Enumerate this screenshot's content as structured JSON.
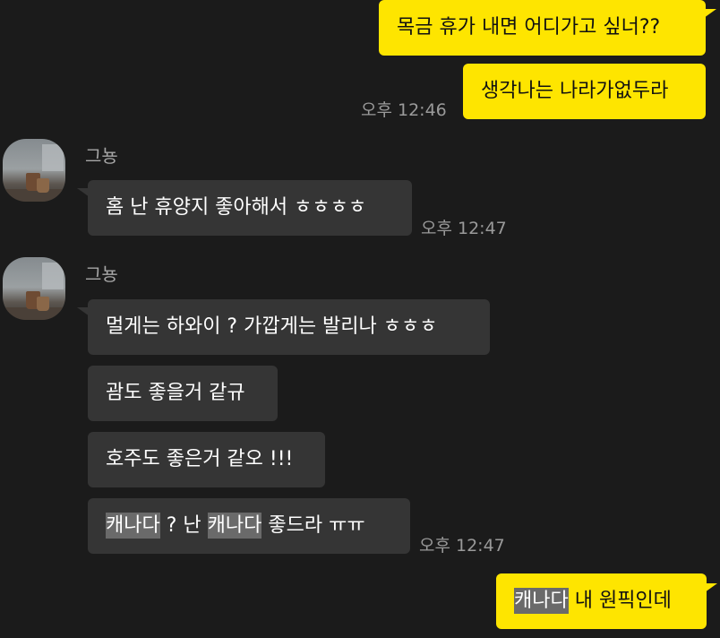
{
  "conversation": {
    "outgoing_1": {
      "text": "목금 휴가 내면 어디가고 싶너??"
    },
    "outgoing_2": {
      "text": "생각나는 나라가없두라",
      "time": "오후 12:46"
    },
    "incoming_group_1": {
      "sender": "그뇽",
      "avatar": "profile-photo-cafe",
      "messages": [
        {
          "text": "홈 난 휴양지 좋아해서 ㅎㅎㅎㅎ"
        }
      ],
      "time": "오후 12:47"
    },
    "incoming_group_2": {
      "sender": "그뇽",
      "avatar": "profile-photo-cafe",
      "messages": [
        {
          "text": "멀게는 하와이 ? 가깝게는 발리나 ㅎㅎㅎ"
        },
        {
          "text": "괌도 좋을거 같규"
        },
        {
          "text": "호주도 좋은거 같오 !!!"
        },
        {
          "parts": [
            "캐나다",
            " ? 난 ",
            "캐나다",
            " 좋드라 ㅠㅠ"
          ]
        }
      ],
      "time": "오후 12:47"
    },
    "outgoing_3": {
      "parts": [
        "캐나다",
        " 내 원픽인데"
      ]
    }
  },
  "colors": {
    "background": "#1b1b1b",
    "outgoing_bubble": "#fee500",
    "incoming_bubble": "#353535",
    "timestamp": "#9a9a9a",
    "search_highlight": "#6a6a6a"
  }
}
